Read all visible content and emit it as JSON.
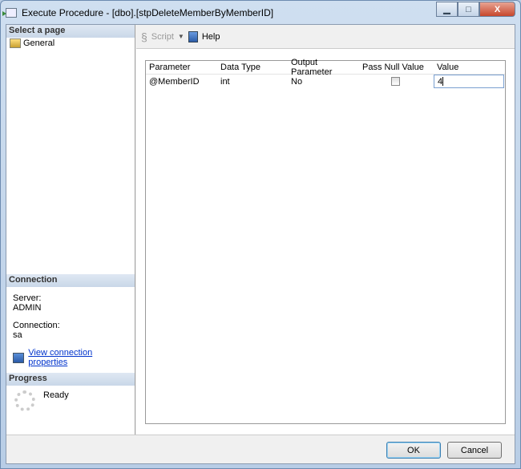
{
  "window": {
    "title": "Execute Procedure - [dbo].[stpDeleteMemberByMemberID]",
    "minimize": "▁",
    "maximize": "□",
    "close": "X"
  },
  "left": {
    "select_page": "Select a page",
    "pages": [
      {
        "label": "General"
      }
    ],
    "connection": {
      "header": "Connection",
      "server_label": "Server:",
      "server": "ADMIN",
      "connection_label": "Connection:",
      "connection": "sa",
      "link": "View connection properties"
    },
    "progress": {
      "header": "Progress",
      "status": "Ready"
    }
  },
  "toolbar": {
    "script": "Script",
    "help": "Help"
  },
  "grid": {
    "columns": [
      "Parameter",
      "Data Type",
      "Output Parameter",
      "Pass Null Value",
      "Value"
    ],
    "rows": [
      {
        "parameter": "@MemberID",
        "data_type": "int",
        "output": "No",
        "pass_null": false,
        "value": "4"
      }
    ]
  },
  "buttons": {
    "ok": "OK",
    "cancel": "Cancel"
  }
}
